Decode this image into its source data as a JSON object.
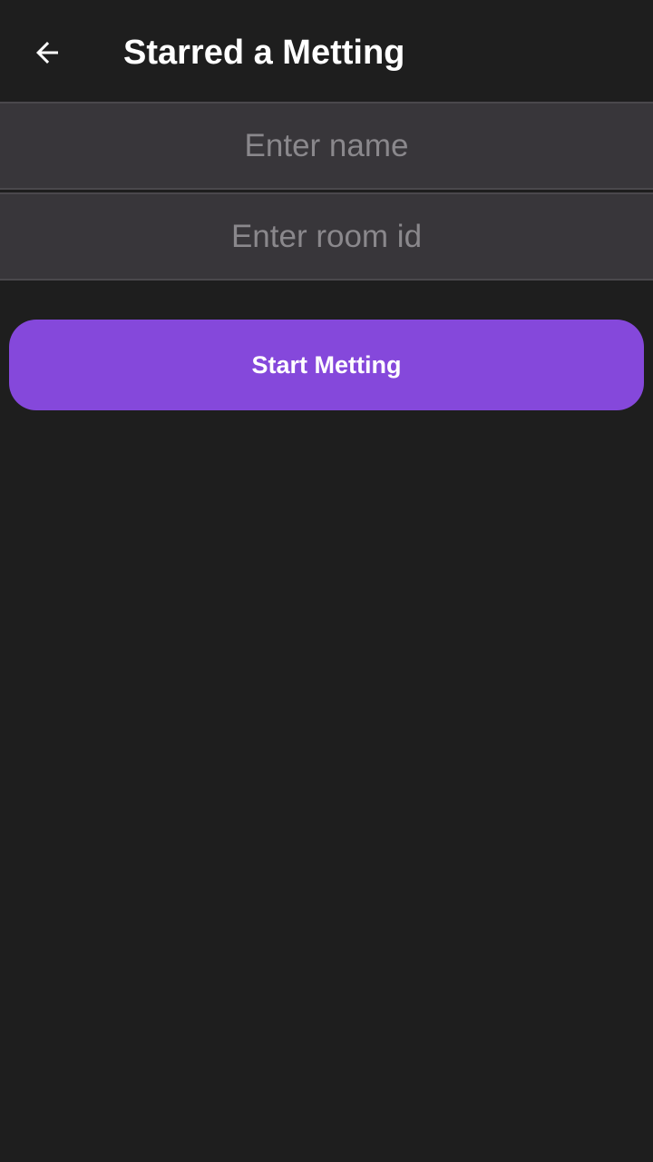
{
  "toolbar": {
    "back_icon": "arrow-left-icon",
    "title": "Starred a Metting"
  },
  "form": {
    "name_field": {
      "value": "",
      "placeholder": "Enter name"
    },
    "room_field": {
      "value": "",
      "placeholder": "Enter room id"
    },
    "start_button_label": "Start Metting"
  },
  "colors": {
    "background": "#1e1e1e",
    "field_background": "#38363a",
    "accent": "#8548db",
    "placeholder": "#8a888c",
    "text": "#ffffff"
  }
}
